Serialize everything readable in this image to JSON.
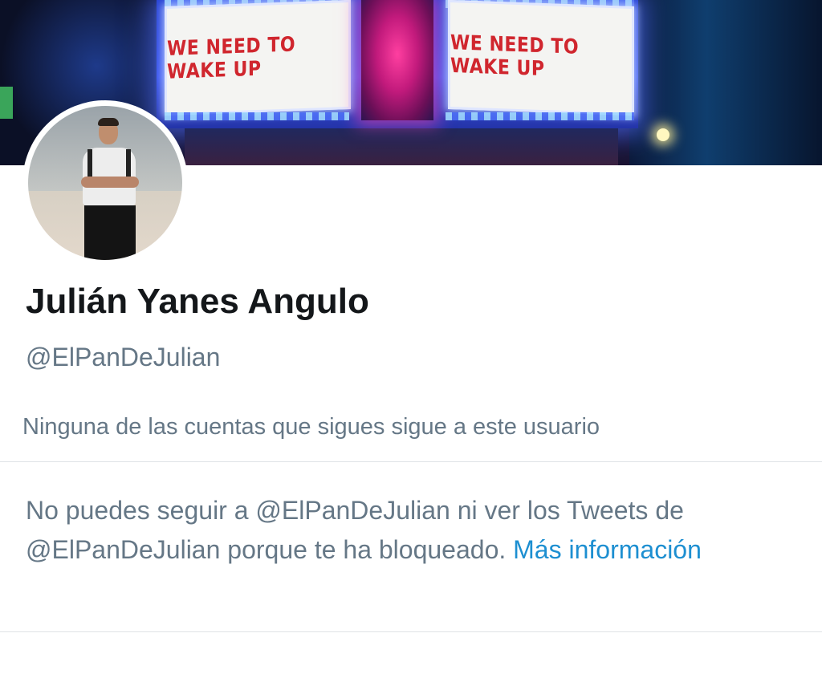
{
  "banner": {
    "sign_left_text": "WE NEED TO WAKE UP",
    "sign_right_text": "WE NEED TO WAKE UP"
  },
  "profile": {
    "name": "Julián Yanes Angulo",
    "handle": "@ElPanDeJulian",
    "followers_you_know": "Ninguna de las cuentas que sigues sigue a este usuario"
  },
  "blocked_notice": {
    "text": "No puedes seguir a @ElPanDeJulian ni ver los Tweets de @ElPanDeJulian porque te ha bloqueado.",
    "link_label": "Más información"
  },
  "colors": {
    "name": "#14171a",
    "secondary_text": "#657786",
    "link": "#1d8fd1",
    "divider": "#dfe3e6"
  }
}
